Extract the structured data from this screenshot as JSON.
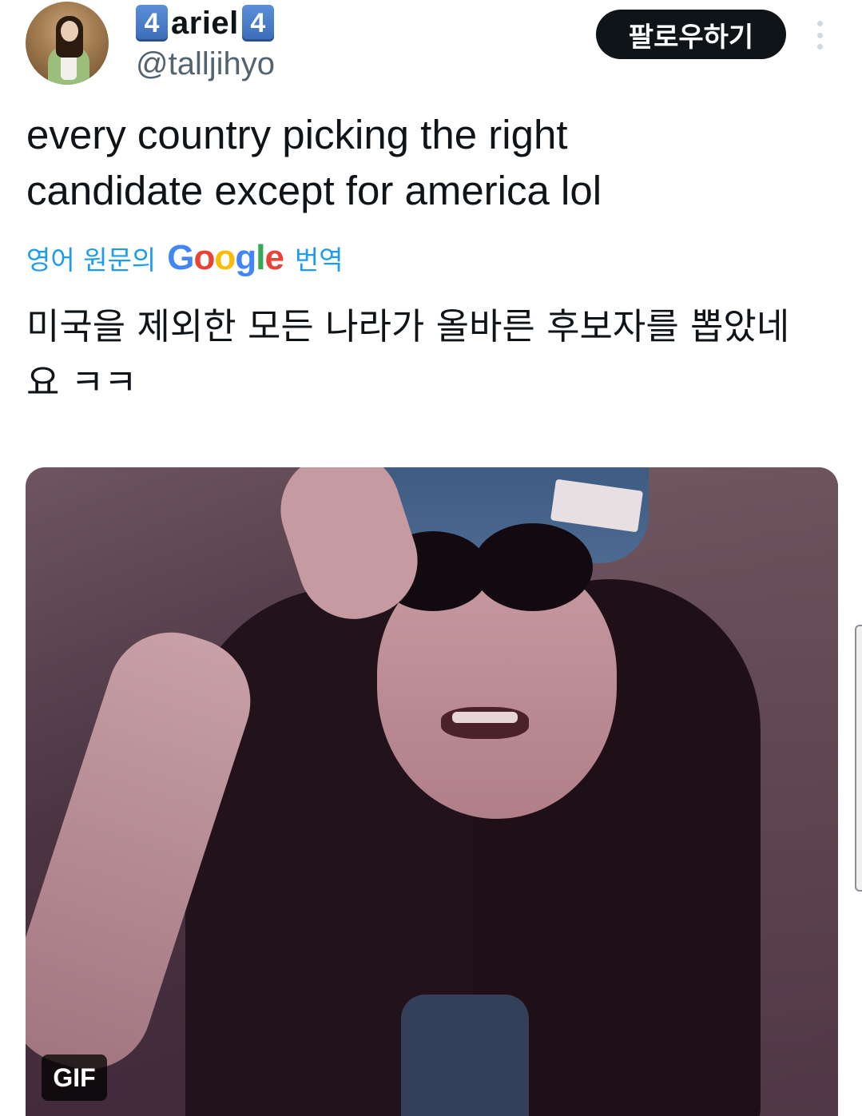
{
  "author": {
    "badge_left": "4",
    "display_name": "ariel",
    "badge_right": "4",
    "handle": "@talljihyo"
  },
  "actions": {
    "follow_label": "팔로우하기",
    "more_icon": "more-vertical-icon"
  },
  "tweet": {
    "text": "every country picking the right candidate except for america lol"
  },
  "translation": {
    "prefix": "영어 원문의",
    "provider": [
      "G",
      "o",
      "o",
      "g",
      "l",
      "e"
    ],
    "suffix": "번역",
    "text": "미국을 제외한 모든 나라가 올바른 후보자를 뽑았네요 ㅋㅋ"
  },
  "media": {
    "badge": "GIF"
  },
  "colors": {
    "follow_bg": "#0f1419",
    "link": "#1d9bf0",
    "handle": "#536471"
  }
}
